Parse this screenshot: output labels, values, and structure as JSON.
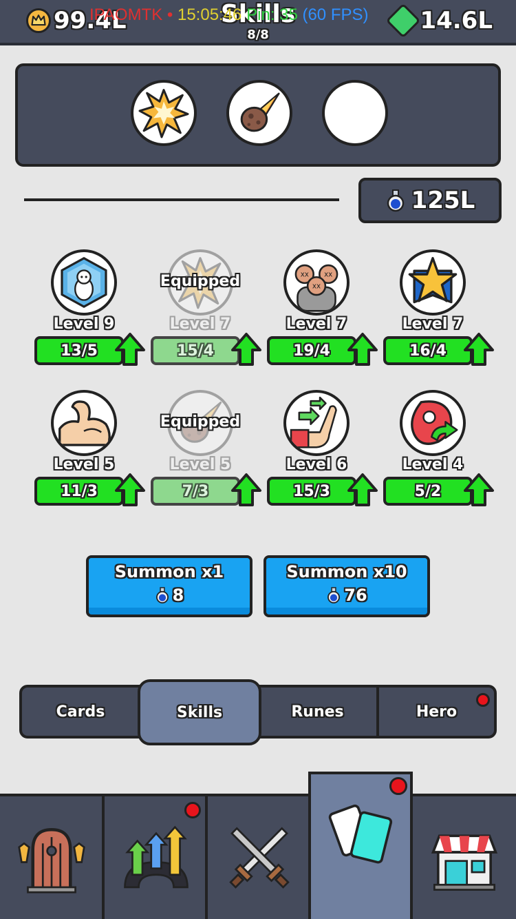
{
  "topbar": {
    "crowns": "99.4L",
    "gems": "14.6L",
    "title": "Skills",
    "subtitle": "8/8",
    "debug": {
      "id": "IPAOMTK",
      "sep": "•",
      "time": "15:05:46",
      "ping": "Pin: 35",
      "fps": "(60 FPS)"
    }
  },
  "equipped_slots": [
    {
      "icon": "explosion-icon"
    },
    {
      "icon": "meteor-icon"
    },
    {
      "icon": "empty-slot"
    }
  ],
  "potions": "125L",
  "equipped_label": "Equipped",
  "skills": [
    {
      "icon": "ice-block-icon",
      "level": "Level 9",
      "progress": "13/5",
      "equipped": false
    },
    {
      "icon": "explosion-icon",
      "level": "Level 7",
      "progress": "15/4",
      "equipped": true
    },
    {
      "icon": "zombies-icon",
      "level": "Level 7",
      "progress": "19/4",
      "equipped": false
    },
    {
      "icon": "star-shield-icon",
      "level": "Level 7",
      "progress": "16/4",
      "equipped": false
    },
    {
      "icon": "muscle-arm-icon",
      "level": "Level 5",
      "progress": "11/3",
      "equipped": false
    },
    {
      "icon": "meteor-icon",
      "level": "Level 5",
      "progress": "7/3",
      "equipped": true
    },
    {
      "icon": "hand-arrows-icon",
      "level": "Level 6",
      "progress": "15/3",
      "equipped": false
    },
    {
      "icon": "meat-heal-icon",
      "level": "Level 4",
      "progress": "5/2",
      "equipped": false
    }
  ],
  "summon": [
    {
      "label": "Summon x1",
      "cost": "8"
    },
    {
      "label": "Summon x10",
      "cost": "76"
    }
  ],
  "tabs": [
    {
      "label": "Cards",
      "active": false,
      "badge": false
    },
    {
      "label": "Skills",
      "active": true,
      "badge": false
    },
    {
      "label": "Runes",
      "active": false,
      "badge": false
    },
    {
      "label": "Hero",
      "active": false,
      "badge": true
    }
  ],
  "bottom_nav": [
    {
      "icon": "door-icon",
      "active": false,
      "badge": false
    },
    {
      "icon": "upgrade-arrows-icon",
      "active": false,
      "badge": true
    },
    {
      "icon": "crossed-swords-icon",
      "active": false,
      "badge": false
    },
    {
      "icon": "cards-icon",
      "active": true,
      "badge": true
    },
    {
      "icon": "shop-icon",
      "active": false,
      "badge": false
    }
  ],
  "colors": {
    "panel": "#454b5c",
    "background": "#e6e6e6",
    "progress_green": "#22e022",
    "summon_blue": "#19a3f2",
    "active_tab": "#7080a0",
    "badge_red": "#e8141c"
  }
}
